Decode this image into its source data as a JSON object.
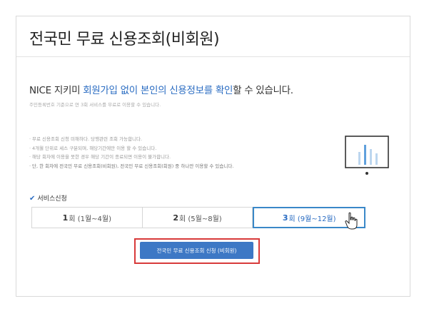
{
  "page": {
    "title": "전국민 무료 신용조회(비회원)",
    "headline": {
      "part1": "NICE 지키미 ",
      "highlight1": "회원가입 없이 본인의 신용정보를 확인",
      "part2": "할 수 있습니다."
    },
    "subnote": "주민등록번호 기준으로 연 3회 서비스를 무료로 이용할 수 있습니다.",
    "bullets": [
      "무료 신용조회 신청 미해하다. 당행관련 조회 가능합니다.",
      "4개월 단위로 세스 구분되며, 해당기간에만 이용 할 수 있습니다.",
      "해당 회차에 이용을 못한 경우 해당 기간이 종료되면 이용이 불가합니다.",
      "단, 한 회차에 전국민 무료 신용조회(비회원), 전국민 무료 신용조회(회원) 중 하나만 이용할 수 있습니다."
    ],
    "service_label": "서비스신청",
    "tabs": [
      {
        "num": "1",
        "unit": "회",
        "range": "(1월~4월)"
      },
      {
        "num": "2",
        "unit": "회",
        "range": "(5월~8월)"
      },
      {
        "num": "3",
        "unit": "회",
        "range": "(9월~12월)"
      }
    ],
    "active_tab": 2,
    "cta_label": "전국민 무료 신용조회 신청 (비회원)"
  },
  "colors": {
    "accent": "#2a6cc2",
    "button": "#3d78c5",
    "highlight_frame": "#d83a3a"
  },
  "icons": [
    "monitor-chart-icon",
    "check-icon",
    "hand-cursor-icon"
  ]
}
